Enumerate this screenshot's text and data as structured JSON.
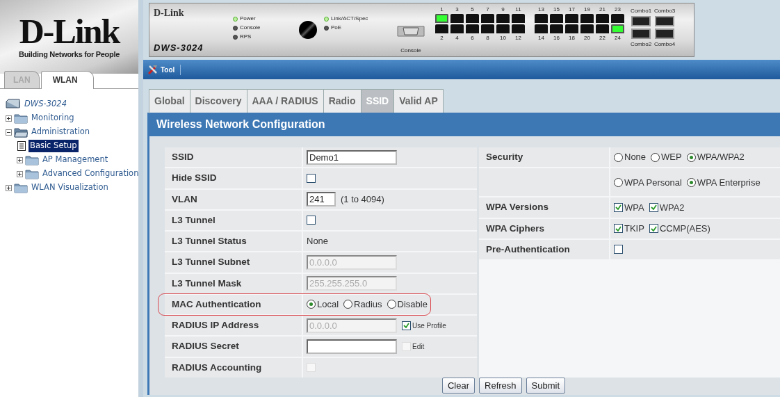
{
  "sidebar": {
    "logo": {
      "brand": "D-Link",
      "tagline": "Building Networks for People"
    },
    "tabs": [
      {
        "label": "LAN",
        "selected": false
      },
      {
        "label": "WLAN",
        "selected": true
      }
    ],
    "tree": [
      {
        "label": "DWS-3024",
        "kind": "device",
        "selected": false
      },
      {
        "label": "Monitoring",
        "kind": "folder",
        "expanded": false,
        "selected": false
      },
      {
        "label": "Administration",
        "kind": "folder",
        "expanded": true,
        "selected": false,
        "children": [
          {
            "label": "Basic Setup",
            "kind": "page",
            "selected": true
          },
          {
            "label": "AP Management",
            "kind": "folder",
            "expanded": false,
            "selected": false
          },
          {
            "label": "Advanced Configuration",
            "kind": "folder",
            "expanded": false,
            "selected": false
          }
        ]
      },
      {
        "label": "WLAN Visualization",
        "kind": "folder",
        "expanded": false,
        "selected": false
      }
    ]
  },
  "device": {
    "brand": "D-Link",
    "model": "DWS-3024",
    "leds": [
      {
        "label": "Power",
        "on": true
      },
      {
        "label": "Console",
        "on": false
      },
      {
        "label": "RPS",
        "on": false
      }
    ],
    "leds_2": [
      {
        "label": "Link/ACT/Spec",
        "on": true
      },
      {
        "label": "PoE",
        "on": false
      }
    ],
    "console_label": "Console",
    "port_groups": [
      {
        "ports": [
          {
            "label": "1",
            "link": true
          },
          {
            "label": "2",
            "link": false
          },
          {
            "label": "3",
            "link": false
          },
          {
            "label": "4",
            "link": false
          },
          {
            "label": "5",
            "link": false
          },
          {
            "label": "6",
            "link": false
          },
          {
            "label": "7",
            "link": false
          },
          {
            "label": "8",
            "link": false
          },
          {
            "label": "9",
            "link": false
          },
          {
            "label": "10",
            "link": false
          },
          {
            "label": "11",
            "link": false
          },
          {
            "label": "12",
            "link": false
          }
        ]
      },
      {
        "ports": [
          {
            "label": "13",
            "link": false
          },
          {
            "label": "14",
            "link": false
          },
          {
            "label": "15",
            "link": false
          },
          {
            "label": "16",
            "link": false
          },
          {
            "label": "17",
            "link": false
          },
          {
            "label": "18",
            "link": false
          },
          {
            "label": "19",
            "link": false
          },
          {
            "label": "20",
            "link": false
          },
          {
            "label": "21",
            "link": false
          },
          {
            "label": "22",
            "link": false
          },
          {
            "label": "23",
            "link": false
          },
          {
            "label": "24",
            "link": true
          }
        ]
      }
    ],
    "combos": [
      {
        "label": "Combo1"
      },
      {
        "label": "Combo2"
      },
      {
        "label": "Combo3"
      },
      {
        "label": "Combo4"
      }
    ]
  },
  "toolbar": {
    "label": "Tool"
  },
  "tabs": [
    {
      "label": "Global",
      "selected": false
    },
    {
      "label": "Discovery",
      "selected": false
    },
    {
      "label": "AAA / RADIUS",
      "selected": false
    },
    {
      "label": "Radio",
      "selected": false
    },
    {
      "label": "SSID",
      "selected": true
    },
    {
      "label": "Valid AP",
      "selected": false
    }
  ],
  "panel_title": "Wireless Network Configuration",
  "left_rows": [
    {
      "label": "SSID",
      "highlighted": false,
      "controls": [
        {
          "kind": "input",
          "value": "Demo1",
          "disabled": false
        }
      ]
    },
    {
      "label": "Hide SSID",
      "highlighted": false,
      "controls": [
        {
          "kind": "check",
          "checked": false,
          "disabled": false
        }
      ]
    },
    {
      "label": "VLAN",
      "highlighted": false,
      "controls": [
        {
          "kind": "short-input",
          "value": "241",
          "disabled": false
        },
        {
          "kind": "note",
          "text": "(1 to 4094)"
        }
      ]
    },
    {
      "label": "L3 Tunnel",
      "highlighted": false,
      "controls": [
        {
          "kind": "check",
          "checked": false,
          "disabled": false
        }
      ]
    },
    {
      "label": "L3 Tunnel Status",
      "highlighted": false,
      "controls": [
        {
          "kind": "note",
          "text": "None"
        }
      ]
    },
    {
      "label": "L3 Tunnel Subnet",
      "highlighted": false,
      "controls": [
        {
          "kind": "input",
          "value": "0.0.0.0",
          "disabled": true
        }
      ]
    },
    {
      "label": "L3 Tunnel Mask",
      "highlighted": false,
      "controls": [
        {
          "kind": "input",
          "value": "255.255.255.0",
          "disabled": true
        }
      ]
    },
    {
      "label": "MAC Authentication",
      "highlighted": true,
      "controls": [
        {
          "kind": "radio",
          "text": "Local",
          "selected": true
        },
        {
          "kind": "radio",
          "text": "Radius",
          "selected": false
        },
        {
          "kind": "radio",
          "text": "Disable",
          "selected": false
        }
      ]
    },
    {
      "label": "RADIUS IP Address",
      "highlighted": false,
      "controls": [
        {
          "kind": "input",
          "value": "0.0.0.0",
          "disabled": true
        },
        {
          "kind": "side-check",
          "text": "Use Profile",
          "checked": true,
          "disabled": false
        }
      ]
    },
    {
      "label": "RADIUS Secret",
      "highlighted": false,
      "controls": [
        {
          "kind": "input",
          "disabled": false
        },
        {
          "kind": "side-check",
          "text": "Edit",
          "checked": false,
          "disabled": true
        }
      ]
    },
    {
      "label": "RADIUS Accounting",
      "highlighted": false,
      "controls": [
        {
          "kind": "check",
          "checked": false,
          "disabled": true
        }
      ]
    }
  ],
  "right_rows": [
    {
      "label": "Security",
      "highlighted": false,
      "controls": [
        {
          "kind": "radio",
          "text": "None",
          "selected": false
        },
        {
          "kind": "radio",
          "text": "WEP",
          "selected": false
        },
        {
          "kind": "radio",
          "text": "WPA/WPA2",
          "selected": true
        }
      ]
    },
    {
      "label": "",
      "highlighted": false,
      "controls": [
        {
          "kind": "radio",
          "text": "WPA Personal",
          "selected": false
        },
        {
          "kind": "radio",
          "text": "WPA Enterprise",
          "selected": true
        }
      ]
    },
    {
      "label": "WPA Versions",
      "highlighted": false,
      "controls": [
        {
          "kind": "check",
          "text": "WPA",
          "checked": true,
          "disabled": false
        },
        {
          "kind": "check",
          "text": "WPA2",
          "checked": true,
          "disabled": false
        }
      ]
    },
    {
      "label": "WPA Ciphers",
      "highlighted": false,
      "controls": [
        {
          "kind": "check",
          "text": "TKIP",
          "checked": true,
          "disabled": false
        },
        {
          "kind": "check",
          "text": "CCMP(AES)",
          "checked": true,
          "disabled": false
        }
      ]
    },
    {
      "label": "Pre-Authentication",
      "highlighted": false,
      "controls": [
        {
          "kind": "check",
          "checked": false,
          "disabled": false
        }
      ]
    }
  ],
  "buttons": [
    "Clear",
    "Refresh",
    "Submit"
  ]
}
